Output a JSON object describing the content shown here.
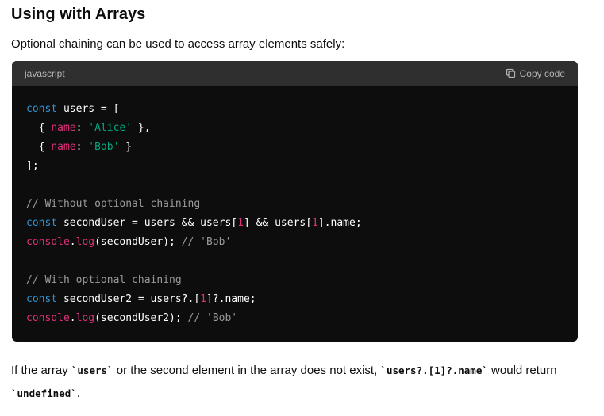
{
  "heading": "Using with Arrays",
  "intro": "Optional chaining can be used to access array elements safely:",
  "code_block": {
    "language": "javascript",
    "copy_label": "Copy code",
    "copy_icon": "copy-icon",
    "background": "#0d0d0d",
    "header_background": "#2f2f2f",
    "colors": {
      "keyword": "#2e95d3",
      "string": "#00a67d",
      "property": "#df3079",
      "comment": "#9a9a9a"
    },
    "lines": [
      [
        {
          "t": "kw",
          "v": "const"
        },
        {
          "t": "pl",
          "v": " users = ["
        }
      ],
      [
        {
          "t": "pl",
          "v": "  { "
        },
        {
          "t": "prop",
          "v": "name"
        },
        {
          "t": "pl",
          "v": ": "
        },
        {
          "t": "str",
          "v": "'Alice'"
        },
        {
          "t": "pl",
          "v": " },"
        }
      ],
      [
        {
          "t": "pl",
          "v": "  { "
        },
        {
          "t": "prop",
          "v": "name"
        },
        {
          "t": "pl",
          "v": ": "
        },
        {
          "t": "str",
          "v": "'Bob'"
        },
        {
          "t": "pl",
          "v": " }"
        }
      ],
      [
        {
          "t": "pl",
          "v": "];"
        }
      ],
      [],
      [
        {
          "t": "cm",
          "v": "// Without optional chaining"
        }
      ],
      [
        {
          "t": "kw",
          "v": "const"
        },
        {
          "t": "pl",
          "v": " secondUser = users && users["
        },
        {
          "t": "num",
          "v": "1"
        },
        {
          "t": "pl",
          "v": "] && users["
        },
        {
          "t": "num",
          "v": "1"
        },
        {
          "t": "pl",
          "v": "].name;"
        }
      ],
      [
        {
          "t": "fn",
          "v": "console"
        },
        {
          "t": "pl",
          "v": "."
        },
        {
          "t": "fn",
          "v": "log"
        },
        {
          "t": "pl",
          "v": "(secondUser); "
        },
        {
          "t": "cm",
          "v": "// 'Bob'"
        }
      ],
      [],
      [
        {
          "t": "cm",
          "v": "// With optional chaining"
        }
      ],
      [
        {
          "t": "kw",
          "v": "const"
        },
        {
          "t": "pl",
          "v": " secondUser2 = users?.["
        },
        {
          "t": "num",
          "v": "1"
        },
        {
          "t": "pl",
          "v": "]?.name;"
        }
      ],
      [
        {
          "t": "fn",
          "v": "console"
        },
        {
          "t": "pl",
          "v": "."
        },
        {
          "t": "fn",
          "v": "log"
        },
        {
          "t": "pl",
          "v": "(secondUser2); "
        },
        {
          "t": "cm",
          "v": "// 'Bob'"
        }
      ]
    ]
  },
  "outro": {
    "part1": "If the array ",
    "code1": "`users`",
    "part2": " or the second element in the array does not exist, ",
    "code2": "`users?.[1]?.name`",
    "part3": " would return ",
    "code3": "`undefined`",
    "part4": "."
  }
}
